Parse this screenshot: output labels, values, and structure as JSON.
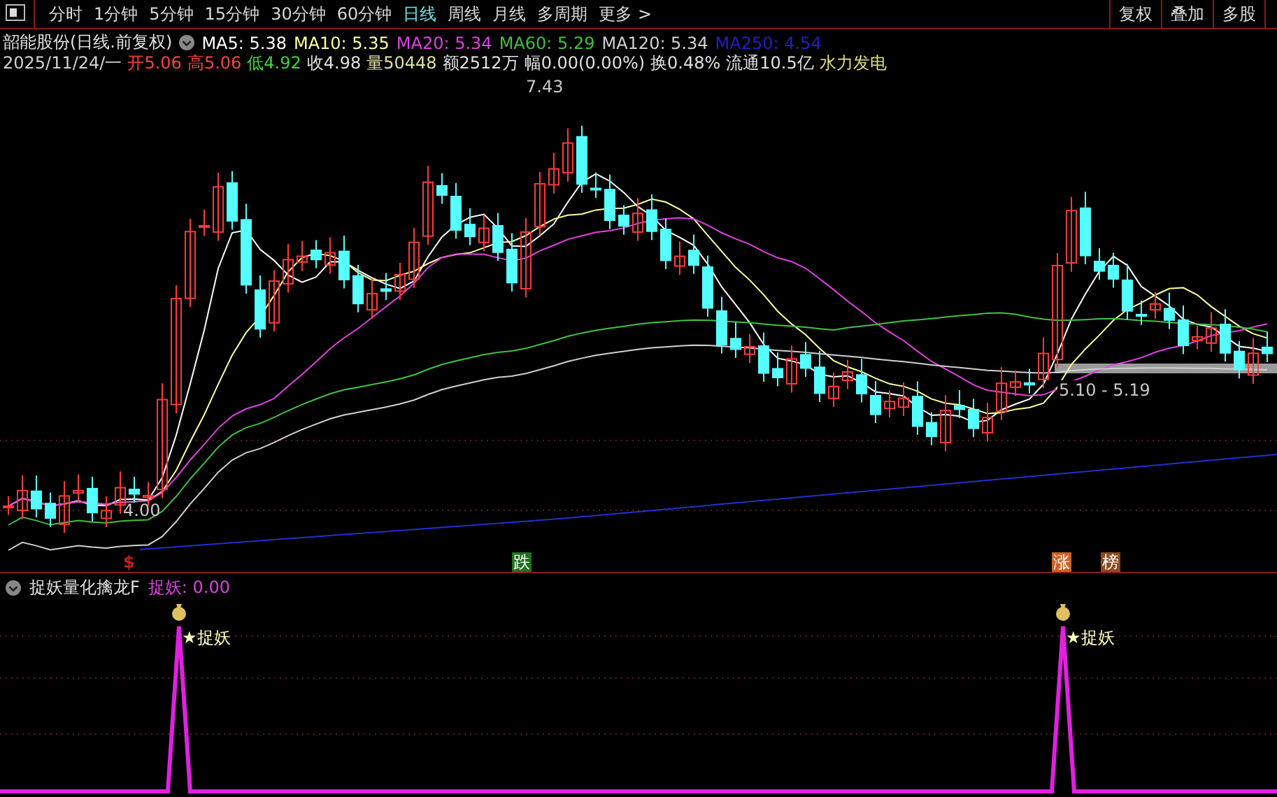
{
  "toolbar": {
    "periods": [
      {
        "label": "分时",
        "selected": false
      },
      {
        "label": "1分钟",
        "selected": false
      },
      {
        "label": "5分钟",
        "selected": false
      },
      {
        "label": "15分钟",
        "selected": false
      },
      {
        "label": "30分钟",
        "selected": false
      },
      {
        "label": "60分钟",
        "selected": false
      },
      {
        "label": "日线",
        "selected": true
      },
      {
        "label": "周线",
        "selected": false
      },
      {
        "label": "月线",
        "selected": false
      },
      {
        "label": "多周期",
        "selected": false
      },
      {
        "label": "更多 >",
        "selected": false
      }
    ],
    "buttons": [
      "复权",
      "叠加",
      "多股"
    ]
  },
  "header": {
    "title": "韶能股份(日线.前复权)",
    "moving_averages": [
      {
        "label": "MA5: 5.38",
        "color": "#ffffff"
      },
      {
        "label": "MA10: 5.35",
        "color": "#ffffa0"
      },
      {
        "label": "MA20: 5.34",
        "color": "#e040e0"
      },
      {
        "label": "MA60: 5.29",
        "color": "#40c040"
      },
      {
        "label": "MA120: 5.34",
        "color": "#d0d0d0"
      },
      {
        "label": "MA250: 4.54",
        "color": "#2020c0"
      }
    ]
  },
  "quote": [
    {
      "text": "2025/11/24/一",
      "color": "#d0d0d0"
    },
    {
      "text": "开5.06",
      "color": "#ff4040"
    },
    {
      "text": "高5.06",
      "color": "#ff4040"
    },
    {
      "text": "低4.92",
      "color": "#40d040"
    },
    {
      "text": "收4.98",
      "color": "#e0e0e0"
    },
    {
      "text": "量50448",
      "color": "#e0e0a0"
    },
    {
      "text": "额2512万",
      "color": "#e0e0e0"
    },
    {
      "text": "幅0.00(0.00%)",
      "color": "#e0e0e0"
    },
    {
      "text": "换0.48%",
      "color": "#e0e0e0"
    },
    {
      "text": "流通10.5亿",
      "color": "#e0e0e0"
    },
    {
      "text": "水力发电",
      "color": "#e0e080"
    }
  ],
  "price_labels": {
    "high": "7.43",
    "low": "4.00",
    "range": "5.10 - 5.19"
  },
  "signals": [
    {
      "text": "$",
      "color": "#c02020"
    },
    {
      "text": "跌",
      "color": "#207020"
    },
    {
      "text": "涨",
      "color": "#d06020"
    },
    {
      "text": "榜",
      "color": "#8a4a20"
    }
  ],
  "indicator": {
    "title": "捉妖量化擒龙F",
    "reading": "捉妖: 0.00",
    "alerts": [
      "★捉妖",
      "★捉妖"
    ]
  }
}
